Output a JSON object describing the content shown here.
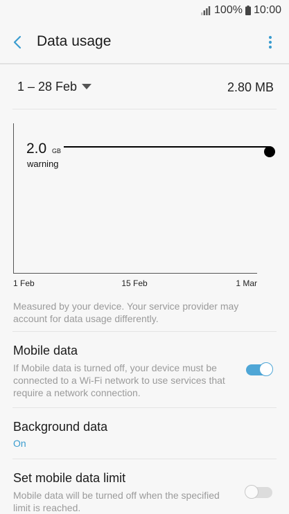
{
  "status_bar": {
    "battery_percent": "100%",
    "time": "10:00",
    "signal_icon": "signal-icon",
    "battery_icon": "battery-icon"
  },
  "header": {
    "title": "Data usage",
    "back_icon": "back-arrow-icon",
    "more_icon": "more-options-icon"
  },
  "cycle": {
    "range": "1 – 28 Feb",
    "total": "2.80 MB"
  },
  "chart_data": {
    "type": "line",
    "warning_value": "2.0",
    "warning_unit": "GB",
    "warning_label": "warning",
    "x_ticks": [
      "1 Feb",
      "15 Feb",
      "1 Mar"
    ],
    "colors": {
      "axis": "#555555",
      "warning_line": "#000000"
    }
  },
  "note": "Measured by your device. Your service provider may account for data usage differently.",
  "settings": {
    "mobile_data": {
      "label": "Mobile data",
      "summary": "If Mobile data is turned off, your device must be connected to a Wi-Fi network to use services that require a network connection.",
      "enabled": true
    },
    "background_data": {
      "label": "Background data",
      "summary": "On"
    },
    "data_limit": {
      "label": "Set mobile data limit",
      "summary": "Mobile data will be turned off when the specified limit is reached.",
      "enabled": false
    }
  },
  "colors": {
    "accent": "#3a9ccf",
    "background": "#f7f7f7"
  }
}
